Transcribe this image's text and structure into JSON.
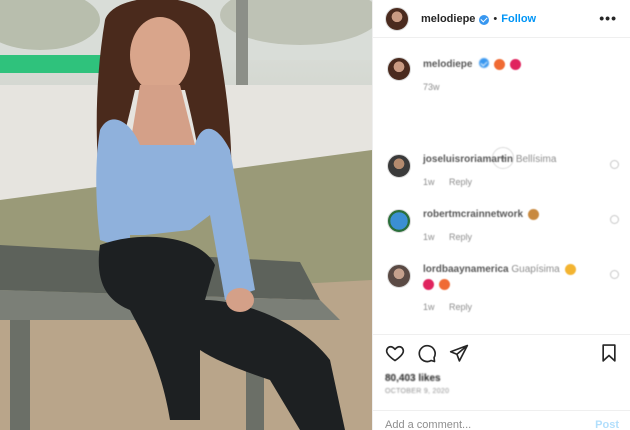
{
  "header": {
    "username": "melodiepe",
    "separator": "•",
    "follow_label": "Follow",
    "more_label": "•••"
  },
  "caption": {
    "username": "melodiepe",
    "time": "73w"
  },
  "comments": [
    {
      "username": "joseluisroriamartin",
      "text": "Bellísima",
      "time": "1w",
      "reply_label": "Reply"
    },
    {
      "username": "robertmcrainnetwork",
      "text": "",
      "time": "1w",
      "reply_label": "Reply"
    },
    {
      "username": "lordbaaynamerica",
      "text": "Guapísima",
      "time": "1w",
      "reply_label": "Reply"
    }
  ],
  "load_more_icon": "plus-circle-icon",
  "actions": {
    "icons": [
      "heart-icon",
      "comment-icon",
      "share-icon",
      "bookmark-icon"
    ],
    "likes": "80,403 likes",
    "date": "OCTOBER 9, 2020"
  },
  "add_comment": {
    "placeholder": "Add a comment...",
    "post_label": "Post"
  },
  "colors": {
    "accent": "#0095f6",
    "post_disabled": "#b2dffc",
    "border": "#efefef"
  }
}
